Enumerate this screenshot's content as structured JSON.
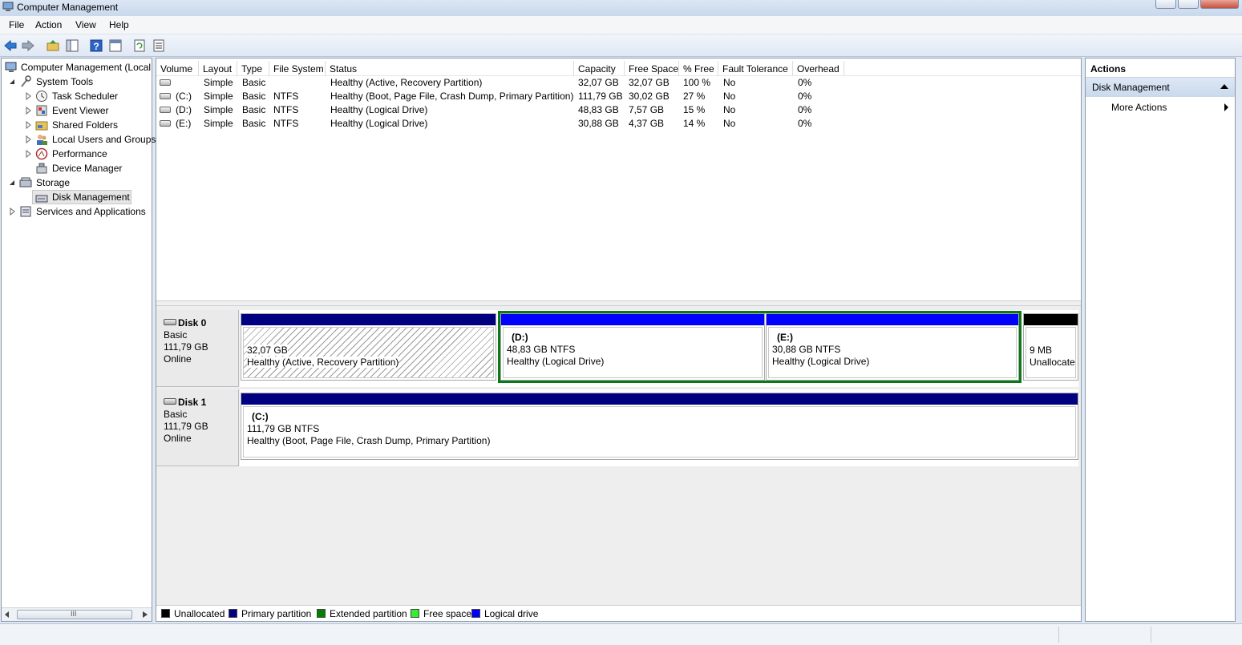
{
  "window": {
    "title": "Computer Management"
  },
  "menu": [
    "File",
    "Action",
    "View",
    "Help"
  ],
  "toolbar": [
    "back-icon",
    "forward-icon",
    "up-folder-icon",
    "show-hide-tree-icon",
    "help-icon",
    "properties-icon",
    "refresh-icon",
    "export-list-icon"
  ],
  "tree": {
    "root": "Computer Management (Local",
    "system_tools": "System Tools",
    "task_scheduler": "Task Scheduler",
    "event_viewer": "Event Viewer",
    "shared_folders": "Shared Folders",
    "local_users": "Local Users and Groups",
    "performance": "Performance",
    "device_manager": "Device Manager",
    "storage": "Storage",
    "disk_management": "Disk Management",
    "services": "Services and Applications",
    "scroll_grip": "III"
  },
  "volumes": {
    "columns": [
      "Volume",
      "Layout",
      "Type",
      "File System",
      "Status",
      "Capacity",
      "Free Space",
      "% Free",
      "Fault Tolerance",
      "Overhead"
    ],
    "rows": [
      [
        "",
        "Simple",
        "Basic",
        "",
        "Healthy (Active, Recovery Partition)",
        "32,07 GB",
        "32,07 GB",
        "100 %",
        "No",
        "0%"
      ],
      [
        "(C:)",
        "Simple",
        "Basic",
        "NTFS",
        "Healthy (Boot, Page File, Crash Dump, Primary Partition)",
        "111,79 GB",
        "30,02 GB",
        "27 %",
        "No",
        "0%"
      ],
      [
        "(D:)",
        "Simple",
        "Basic",
        "NTFS",
        "Healthy (Logical Drive)",
        "48,83 GB",
        "7,57 GB",
        "15 %",
        "No",
        "0%"
      ],
      [
        "(E:)",
        "Simple",
        "Basic",
        "NTFS",
        "Healthy (Logical Drive)",
        "30,88 GB",
        "4,37 GB",
        "14 %",
        "No",
        "0%"
      ]
    ]
  },
  "disks": [
    {
      "name": "Disk 0",
      "type": "Basic",
      "size": "111,79 GB",
      "state": "Online",
      "partitions": [
        {
          "letter": "",
          "size": "32,07 GB",
          "status": "Healthy (Active, Recovery Partition)"
        },
        {
          "letter": "(D:)",
          "size": "48,83 GB NTFS",
          "status": "Healthy (Logical Drive)"
        },
        {
          "letter": "(E:)",
          "size": "30,88 GB NTFS",
          "status": "Healthy (Logical Drive)"
        },
        {
          "letter": "",
          "size": "9 MB",
          "status": "Unallocate"
        }
      ]
    },
    {
      "name": "Disk 1",
      "type": "Basic",
      "size": "111,79 GB",
      "state": "Online",
      "partitions": [
        {
          "letter": "(C:)",
          "size": "111,79 GB NTFS",
          "status": "Healthy (Boot, Page File, Crash Dump, Primary Partition)"
        }
      ]
    }
  ],
  "legend": [
    {
      "label": "Unallocated",
      "color": "#000000"
    },
    {
      "label": "Primary partition",
      "color": "#000080"
    },
    {
      "label": "Extended partition",
      "color": "#008000"
    },
    {
      "label": "Free space",
      "color": "#33ee33"
    },
    {
      "label": "Logical drive",
      "color": "#0000ff"
    }
  ],
  "actions": {
    "title": "Actions",
    "section": "Disk Management",
    "more": "More Actions"
  },
  "colors": {
    "primary": "#000080",
    "logical": "#0000ff",
    "extended": "#008000",
    "unallocated": "#000000"
  }
}
